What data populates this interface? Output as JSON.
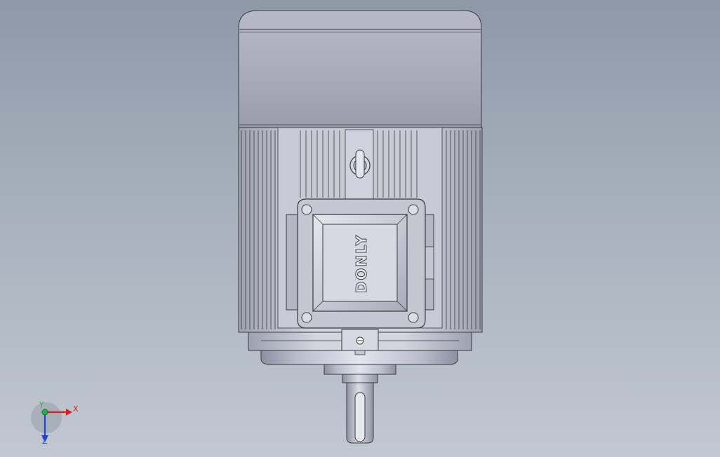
{
  "viewport": {
    "background_top": "#8e99a8",
    "background_bottom": "#c2c8d1"
  },
  "model": {
    "brand_text": "DONLY",
    "body_color": "#c9ccd8",
    "edge_color": "#3a3a3a"
  },
  "triad": {
    "x_label": "X",
    "y_label": "Y",
    "z_label": "Z",
    "x_color": "#d81e1e",
    "y_color": "#26b04a",
    "z_color": "#2a3fd8"
  }
}
